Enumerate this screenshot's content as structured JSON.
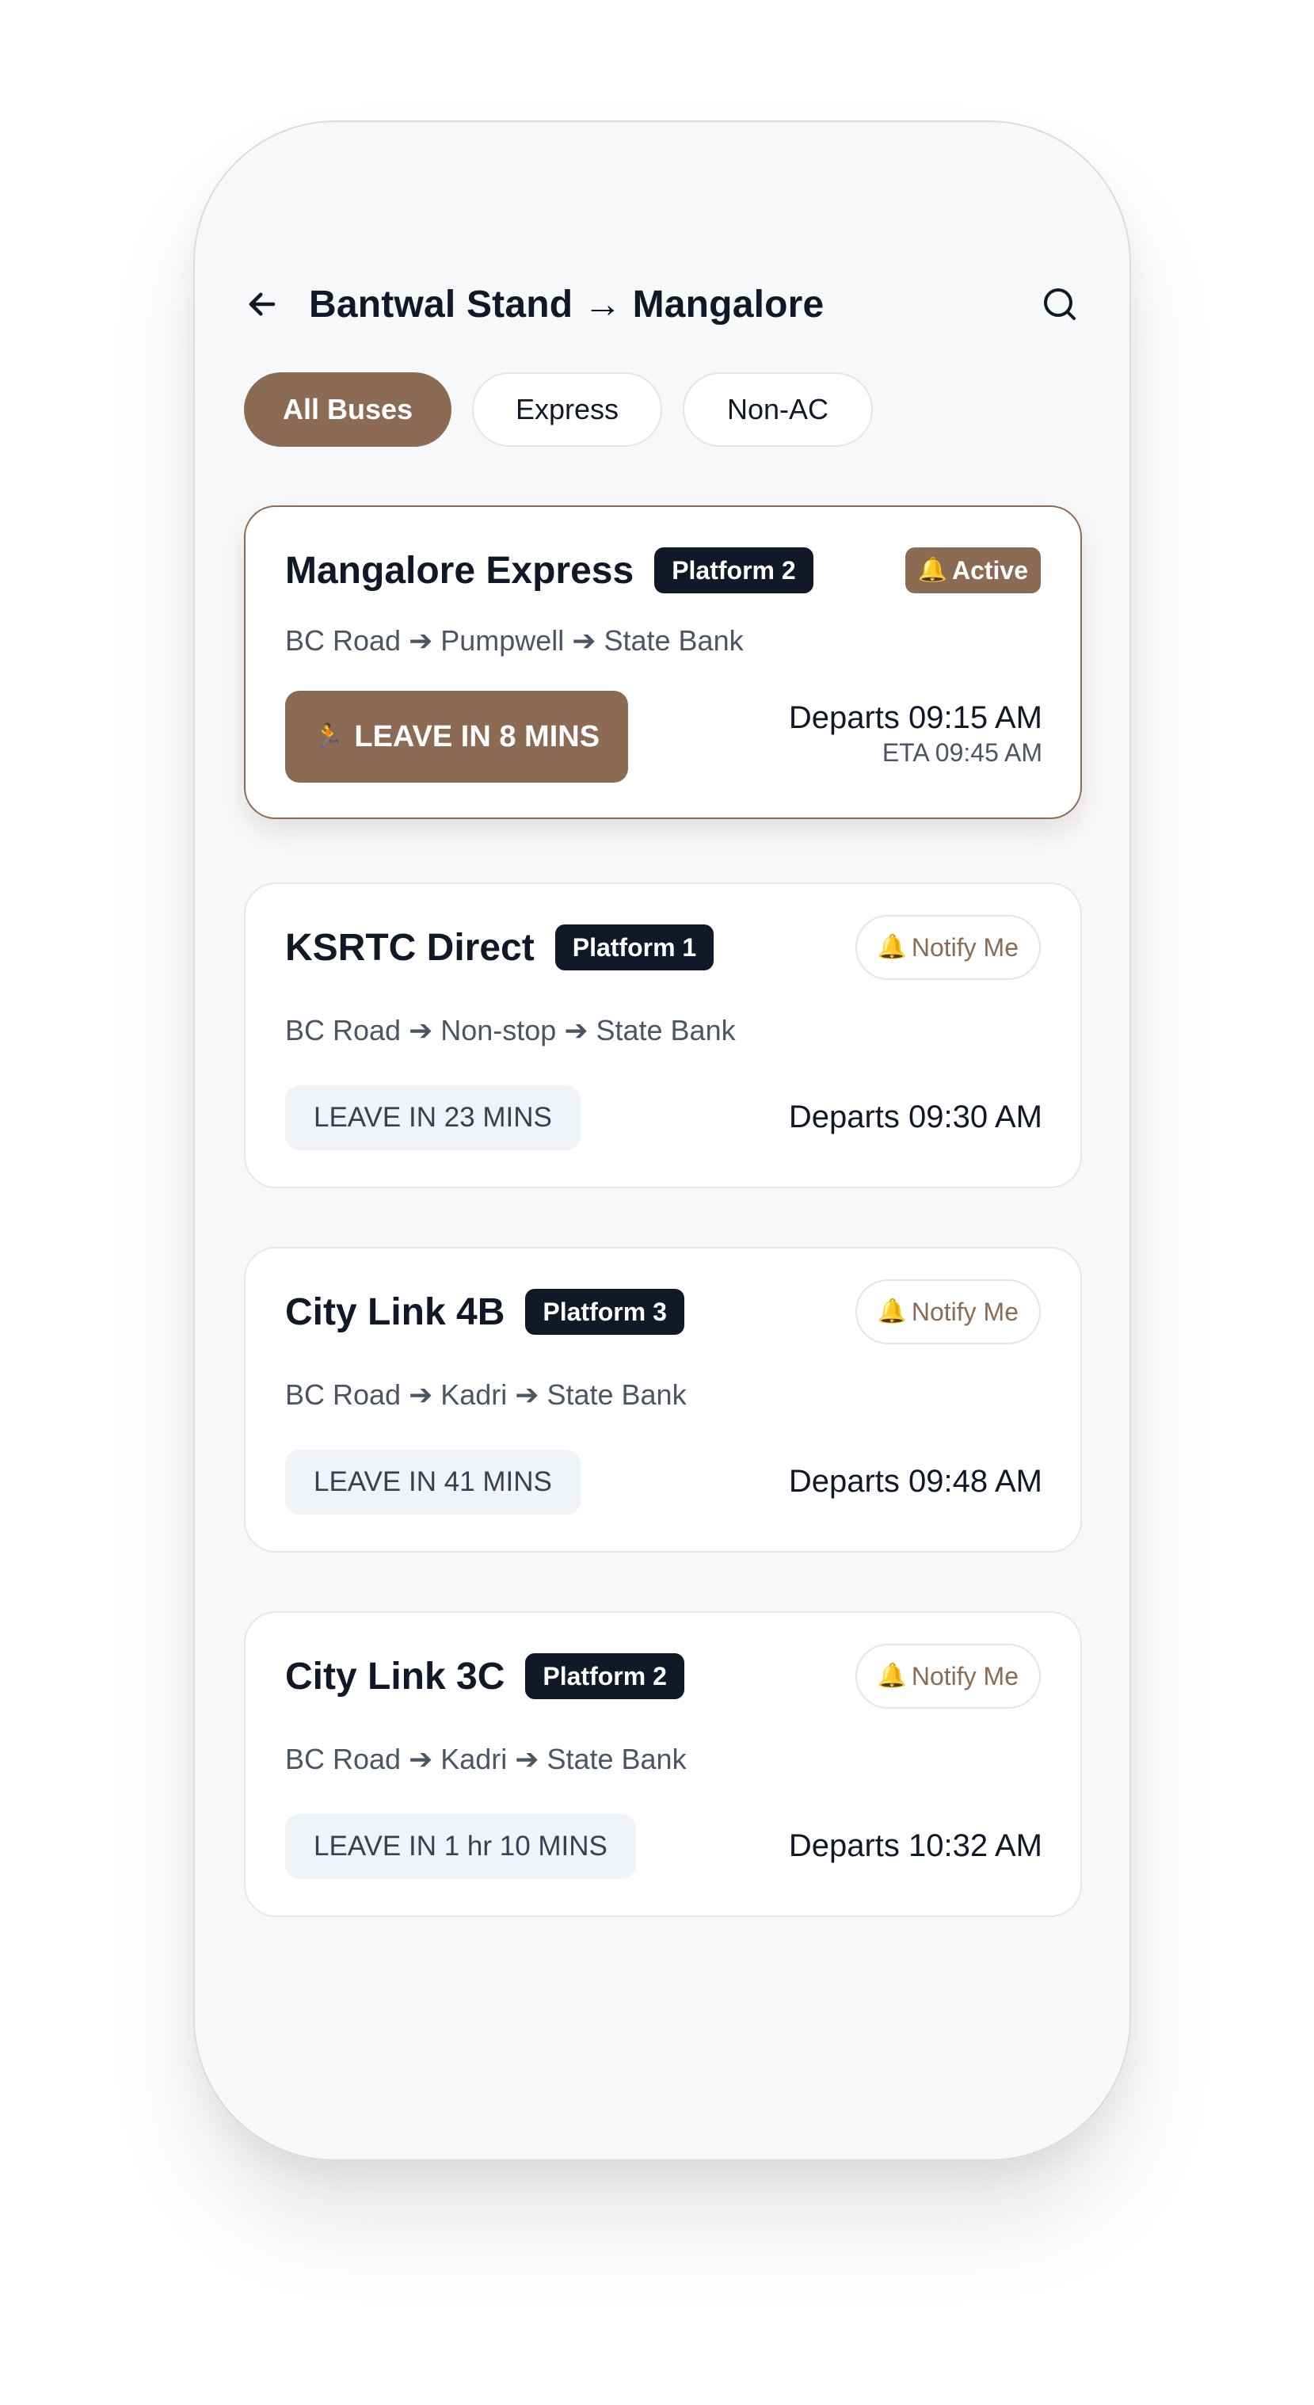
{
  "header": {
    "back_icon": "arrow-left-icon",
    "title": "Bantwal Stand → Mangalore",
    "search_icon": "search-icon"
  },
  "filters": [
    {
      "label": "All Buses",
      "active": true
    },
    {
      "label": "Express",
      "active": false
    },
    {
      "label": "Non-AC",
      "active": false
    }
  ],
  "colors": {
    "accent": "#8b6b54",
    "platform_badge": "#111827",
    "background": "#f7f8fa"
  },
  "buses": [
    {
      "name": "Mangalore Express",
      "platform": "Platform 2",
      "status_icon": "🔔",
      "status_label": "Active",
      "route": "BC Road ➔ Pumpwell ➔ State Bank",
      "leave_icon": "🏃",
      "leave_label": "LEAVE IN 8 MINS",
      "departs": "Departs 09:15 AM",
      "eta": "ETA 09:45 AM"
    },
    {
      "name": "KSRTC Direct",
      "platform": "Platform 1",
      "notify_icon": "🔔",
      "notify_label": "Notify Me",
      "route": "BC Road ➔ Non-stop ➔ State Bank",
      "leave_label": "LEAVE IN 23 MINS",
      "departs": "Departs 09:30 AM"
    },
    {
      "name": "City Link 4B",
      "platform": "Platform 3",
      "notify_icon": "🔔",
      "notify_label": "Notify Me",
      "route": "BC Road ➔ Kadri ➔ State Bank",
      "leave_label": "LEAVE IN 41 MINS",
      "departs": "Departs 09:48 AM"
    },
    {
      "name": "City Link 3C",
      "platform": "Platform 2",
      "notify_icon": "🔔",
      "notify_label": "Notify Me",
      "route": "BC Road ➔ Kadri ➔ State Bank",
      "leave_label": "LEAVE IN 1 hr 10 MINS",
      "departs": "Departs 10:32 AM"
    }
  ]
}
